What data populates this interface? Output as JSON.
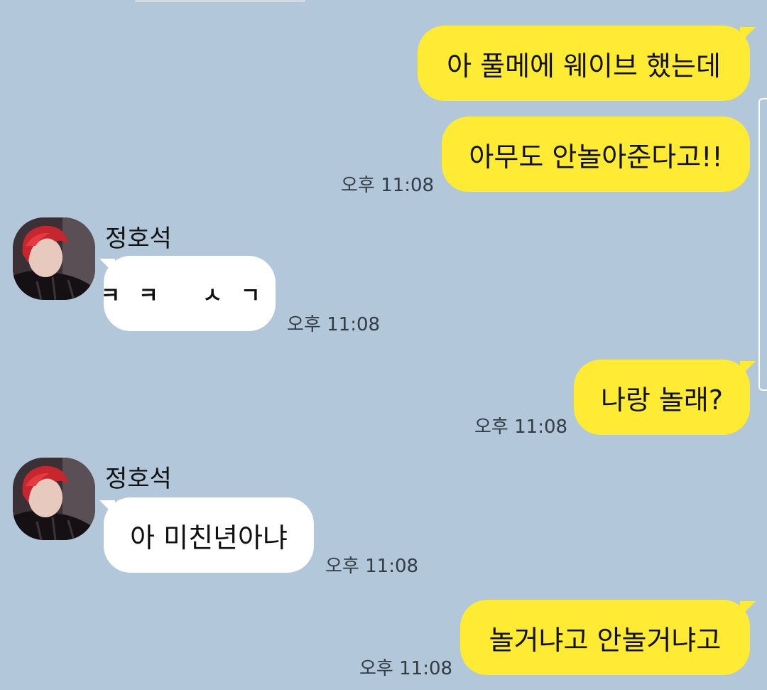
{
  "chat": {
    "messages": [
      {
        "side": "sent",
        "text": "아 풀메에 웨이브 했는데"
      },
      {
        "side": "sent",
        "text": "아무도 안놀아준다고!!",
        "time": "오후 11:08"
      },
      {
        "side": "received",
        "sender": "정호석",
        "text": "ㅋㅋ ㅅㄱ",
        "time": "오후 11:08"
      },
      {
        "side": "sent",
        "text": "나랑 놀래?",
        "time": "오후 11:08"
      },
      {
        "side": "received",
        "sender": "정호석",
        "text": "아 미친년아냐",
        "time": "오후 11:08"
      },
      {
        "side": "sent",
        "text": "놀거냐고 안놀거냐고",
        "time": "오후 11:08"
      }
    ]
  },
  "colors": {
    "background": "#b2c7da",
    "sent_bubble": "#ffeb33",
    "received_bubble": "#ffffff"
  },
  "icons": {
    "avatar": "profile-photo-red-hair"
  }
}
